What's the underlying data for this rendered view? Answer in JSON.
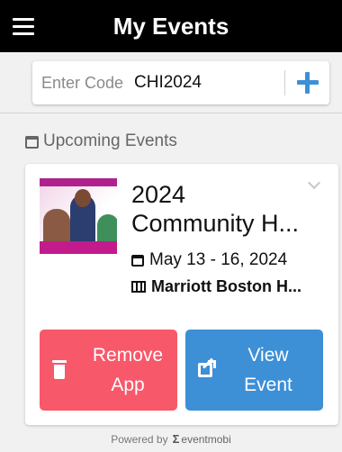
{
  "header": {
    "title": "My Events",
    "menu_icon": "hamburger-menu-icon"
  },
  "code_entry": {
    "label": "Enter Code",
    "value": "CHI2024",
    "add_icon": "plus-icon"
  },
  "section": {
    "title": "Upcoming Events",
    "icon": "calendar-icon"
  },
  "event": {
    "title_line1": "2024",
    "title_line2": "Community H...",
    "date": "May 13 - 16, 2024",
    "venue": "Marriott Boston H...",
    "remove_label": "Remove App",
    "view_label": "View Event"
  },
  "footer": {
    "powered_by": "Powered by",
    "brand": "eventmobi"
  },
  "colors": {
    "header_bg": "#000000",
    "accent_blue": "#3d8fd6",
    "remove_red": "#f7586a"
  }
}
